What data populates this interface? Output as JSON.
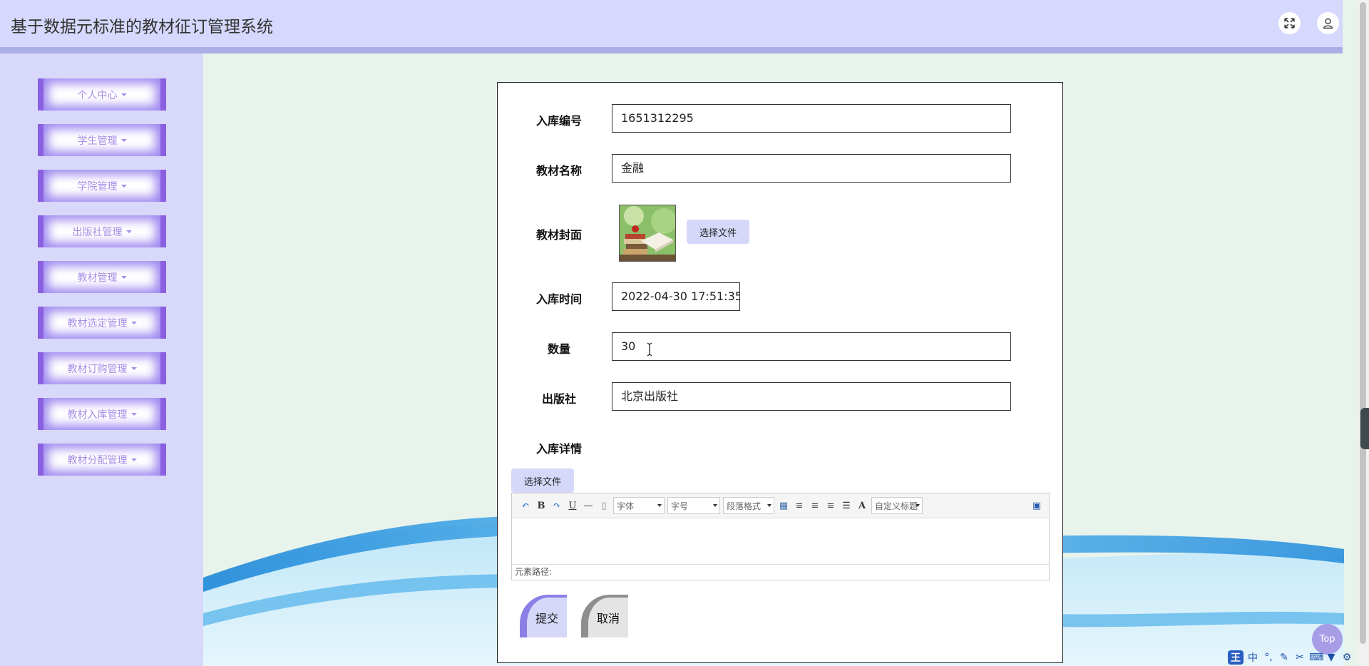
{
  "header": {
    "title": "基于数据元标准的教材征订管理系统"
  },
  "sidebar": {
    "items": [
      {
        "label": "个人中心"
      },
      {
        "label": "学生管理"
      },
      {
        "label": "学院管理"
      },
      {
        "label": "出版社管理"
      },
      {
        "label": "教材管理"
      },
      {
        "label": "教材选定管理"
      },
      {
        "label": "教材订购管理"
      },
      {
        "label": "教材入库管理"
      },
      {
        "label": "教材分配管理"
      }
    ]
  },
  "form": {
    "stock_no_label": "入库编号",
    "stock_no_value": "1651312295",
    "name_label": "教材名称",
    "name_value": "金融",
    "cover_label": "教材封面",
    "cover_file_button": "选择文件",
    "time_label": "入库时间",
    "time_value": "2022-04-30 17:51:35",
    "quantity_label": "数量",
    "quantity_value": "30",
    "publisher_label": "出版社",
    "publisher_value": "北京出版社",
    "detail_label": "入库详情",
    "detail_file_button": "选择文件",
    "submit_label": "提交",
    "cancel_label": "取消"
  },
  "editor": {
    "font_select": "字体",
    "size_select": "字号",
    "paragraph_select": "段落格式",
    "custom_title_select": "自定义标题",
    "bold": "B",
    "underline": "U",
    "font_color": "A",
    "element_path": "元素路径:"
  },
  "top_button": "Top",
  "ime": {
    "logo": "王",
    "mode": "中"
  }
}
